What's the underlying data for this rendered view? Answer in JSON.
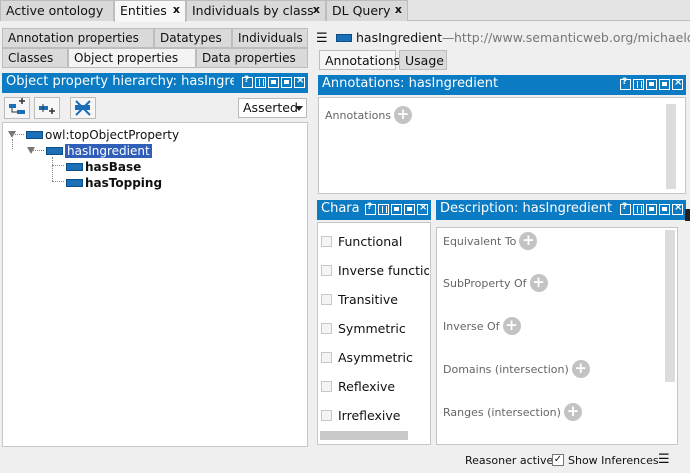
{
  "top_tabs": [
    {
      "label": "Active ontology",
      "closable": false
    },
    {
      "label": "Entities",
      "closable": true
    },
    {
      "label": "Individuals by class",
      "closable": true
    },
    {
      "label": "DL Query",
      "closable": true
    }
  ],
  "close_glyph": "x",
  "left": {
    "subtabs_row1": [
      "Annotation properties",
      "Datatypes",
      "Individuals"
    ],
    "subtabs_row2": [
      "Classes",
      "Object properties",
      "Data properties"
    ],
    "panel_title": "Object property hierarchy: hasIngredient",
    "toolbar": {
      "add_sub_icon": "add-sub-property-icon",
      "add_sibling_icon": "add-sibling-property-icon",
      "delete_icon": "delete-property-icon",
      "mode_select": "Asserted"
    },
    "tree": {
      "root": "owl:topObjectProperty",
      "selected": "hasIngredient",
      "children": [
        "hasBase",
        "hasTopping"
      ]
    }
  },
  "right": {
    "entity_name": "hasIngredient",
    "entity_sep": "—",
    "entity_iri": "http://www.semanticweb.org/michaeldel",
    "tabs": [
      "Annotations",
      "Usage"
    ],
    "annotations": {
      "title": "Annotations: hasIngredient",
      "row_label": "Annotations"
    },
    "characteristics": {
      "title": "Chara",
      "items": [
        "Functional",
        "Inverse functional",
        "Transitive",
        "Symmetric",
        "Asymmetric",
        "Reflexive",
        "Irreflexive"
      ]
    },
    "description": {
      "title": "Description: hasIngredient",
      "sections": [
        "Equivalent To",
        "SubProperty Of",
        "Inverse Of",
        "Domains (intersection)",
        "Ranges (intersection)"
      ]
    }
  },
  "status": {
    "reasoner": "Reasoner active",
    "show_inferences": "Show Inferences",
    "show_inferences_checked": true
  },
  "colors": {
    "accent": "#0b7bc3",
    "selection": "#2f5fb8",
    "property_swatch": "#1b6fb6"
  },
  "plus_glyph": "+"
}
